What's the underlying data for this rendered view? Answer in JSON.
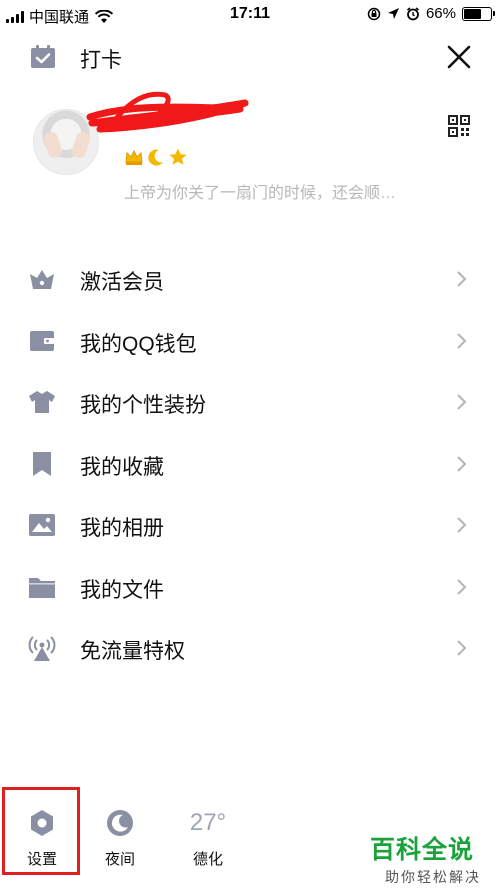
{
  "status_bar": {
    "carrier": "中国联通",
    "time": "17:11",
    "battery": "66%",
    "battery_level": 0.66
  },
  "header": {
    "checkin_label": "打卡"
  },
  "profile": {
    "nickname": "",
    "signature": "上帝为你关了一扇门的时候，还会顺…"
  },
  "menu": {
    "items": [
      {
        "label": "激活会员",
        "icon": "crown-icon"
      },
      {
        "label": "我的QQ钱包",
        "icon": "wallet-icon"
      },
      {
        "label": "我的个性装扮",
        "icon": "shirt-icon"
      },
      {
        "label": "我的收藏",
        "icon": "bookmark-icon"
      },
      {
        "label": "我的相册",
        "icon": "photo-icon"
      },
      {
        "label": "我的文件",
        "icon": "folder-icon"
      },
      {
        "label": "免流量特权",
        "icon": "signal-tower-icon"
      }
    ]
  },
  "bottom_bar": {
    "settings_label": "设置",
    "night_label": "夜间",
    "temperature": "27°",
    "city": "德化"
  },
  "watermark": {
    "title": "百科全说",
    "subtitle": "助你轻松解决"
  },
  "colors": {
    "icon_gray": "#8a8fa3",
    "highlight_red": "#e02020",
    "watermark_green": "#1aa33a",
    "signature_gray": "#b8b8b8"
  }
}
